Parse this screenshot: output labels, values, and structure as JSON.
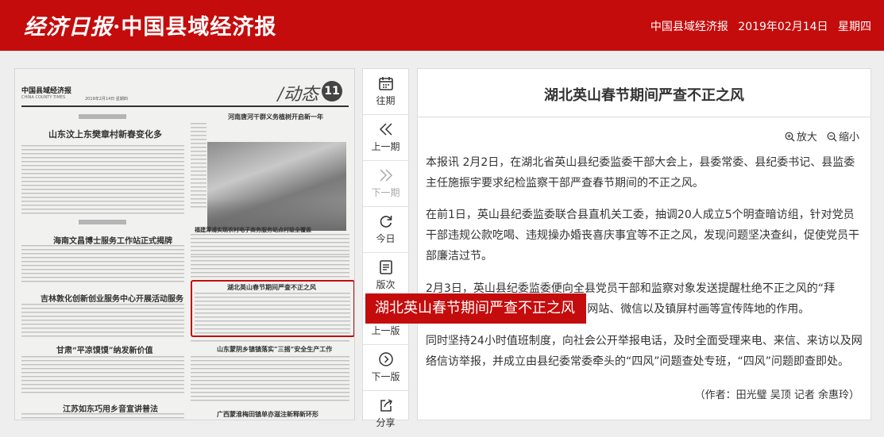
{
  "header": {
    "logo_script": "经济日报",
    "logo_dot": "·",
    "logo_name": "中国县域经济报",
    "site_name": "中国县域经济报",
    "date": "2019年02月14日",
    "weekday": "星期四",
    "bg_color": "#c40c0c"
  },
  "paper_page": {
    "masthead": "中国县域经济报",
    "masthead_en": "CHINA COUNTY TIMES",
    "date_line": "2019年2月14日 星期四",
    "section": "/动态",
    "page_no": "11",
    "headlines": [
      "山东汶上东樊章村新春变化多",
      "河南唐河干群义务植树开启新一年",
      "海南文昌博士服务工作站正式揭牌",
      "福建漳浦实现农村电子商务服务站点村级全覆盖",
      "吉林敦化创新创业服务中心开展活动服务",
      "湖北英山春节期间严查不正之风",
      "甘肃“平凉馍馍”纳发新价值",
      "山东蒙阴乡镇镇落实“三摇”安全生产工作",
      "江苏如东巧用乡音宣讲普法",
      "广西蒙淮梅田镇单亦滋注新释新环形"
    ],
    "highlight_tooltip": "湖北英山春节期间严查不正之风"
  },
  "toolbar": [
    {
      "icon": "calendar-icon",
      "label": "往期",
      "enabled": true
    },
    {
      "icon": "double-chevron-left-icon",
      "label": "上一期",
      "enabled": true
    },
    {
      "icon": "double-chevron-right-icon",
      "label": "下一期",
      "enabled": false
    },
    {
      "icon": "refresh-icon",
      "label": "今日",
      "enabled": true
    },
    {
      "icon": "layout-icon",
      "label": "版次",
      "enabled": true
    },
    {
      "icon": "chevron-left-circle-icon",
      "label": "上一版",
      "enabled": true
    },
    {
      "icon": "chevron-right-circle-icon",
      "label": "下一版",
      "enabled": true
    },
    {
      "icon": "share-icon",
      "label": "分享",
      "enabled": true
    }
  ],
  "article": {
    "title": "湖北英山春节期间严查不正之风",
    "zoom_in": "放大",
    "zoom_out": "缩小",
    "paragraphs": [
      "本报讯 2月2日，在湖北省英山县纪委监委干部大会上，县委常委、县纪委书记、县监委主任施振宇要求纪检监察干部严查春节期间的不正之风。",
      "在前1日，英山县纪委监委联合县直机关工委，抽调20人成立5个明查暗访组，针对党员干部违规公款吃喝、违规操办婚丧喜庆事宜等不正之风，发现问题坚决查纠，促使党员干部廉洁过节。",
      "2月3日，英山县纪委监委便向全县党员干部和监察对象发送提醒杜绝不正之风的“拜年”短信，并通过县纪委监委门户网站、微信以及镇屏村画等宣传阵地的作用。",
      "同时坚持24小时值班制度，向社会公开举报电话，及时全面受理来电、来信、来访以及网络信访举报，并成立由县纪委常委牵头的“四风”问题查处专班，“四风”问题即查即处。"
    ],
    "author": "（作者：田光璧 吴顶 记者 余惠玲）"
  }
}
